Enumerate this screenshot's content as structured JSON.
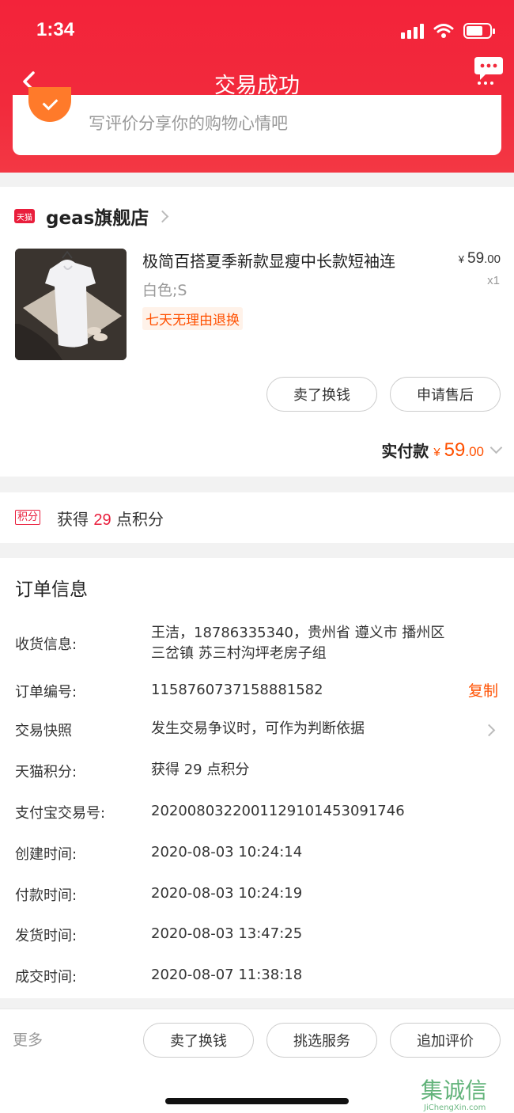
{
  "status_bar": {
    "time": "1:34"
  },
  "nav": {
    "title": "交易成功"
  },
  "review": {
    "text": "写评价分享你的购物心情吧"
  },
  "shop": {
    "badge": "天猫",
    "name": "geas旗舰店",
    "product": {
      "title": "极简百搭夏季新款显瘦中长款短袖连",
      "spec": "白色;S",
      "tag": "七天无理由退换",
      "price_currency": "¥",
      "price_int": "59",
      "price_dec": ".00",
      "quantity": "x1"
    },
    "buttons": {
      "sell": "卖了换钱",
      "after_sale": "申请售后"
    },
    "paid": {
      "label": "实付款",
      "currency": "¥",
      "int": "59",
      "dec": ".00"
    }
  },
  "points": {
    "badge": "积分",
    "prefix": "获得",
    "value": "29",
    "suffix": "点积分"
  },
  "order": {
    "title": "订单信息",
    "rows": [
      {
        "label": "收货信息:",
        "value": "王洁，18786335340，贵州省 遵义市 播州区",
        "value2": "三岔镇 苏三村沟坪老房子组"
      },
      {
        "label": "订单编号:",
        "value": "1158760737158881582",
        "action": "复制"
      },
      {
        "label": "交易快照",
        "value": "发生交易争议时，可作为判断依据"
      },
      {
        "label": "天猫积分:",
        "value": "获得 29 点积分"
      },
      {
        "label": "支付宝交易号:",
        "value": "2020080322001129101453091746"
      },
      {
        "label": "创建时间:",
        "value": "2020-08-03 10:24:14"
      },
      {
        "label": "付款时间:",
        "value": "2020-08-03 10:24:19"
      },
      {
        "label": "发货时间:",
        "value": "2020-08-03 13:47:25"
      },
      {
        "label": "成交时间:",
        "value": "2020-08-07 11:38:18"
      }
    ]
  },
  "bottom": {
    "more": "更多",
    "sell": "卖了换钱",
    "choose_service": "挑选服务",
    "add_review": "追加评价"
  },
  "watermark": {
    "main": "集诚信",
    "sub": "JiChengXin.com"
  },
  "colors": {
    "brand_red": "#f22a3c",
    "accent_orange": "#ff5000",
    "tmall_red": "#e91e3c"
  },
  "icons": [
    "back-chevron-icon",
    "chat-bubble-icon",
    "review-badge-icon",
    "tmall-badge-icon",
    "chevron-right-icon",
    "chevron-down-icon",
    "signal-icon",
    "wifi-icon",
    "battery-icon"
  ]
}
